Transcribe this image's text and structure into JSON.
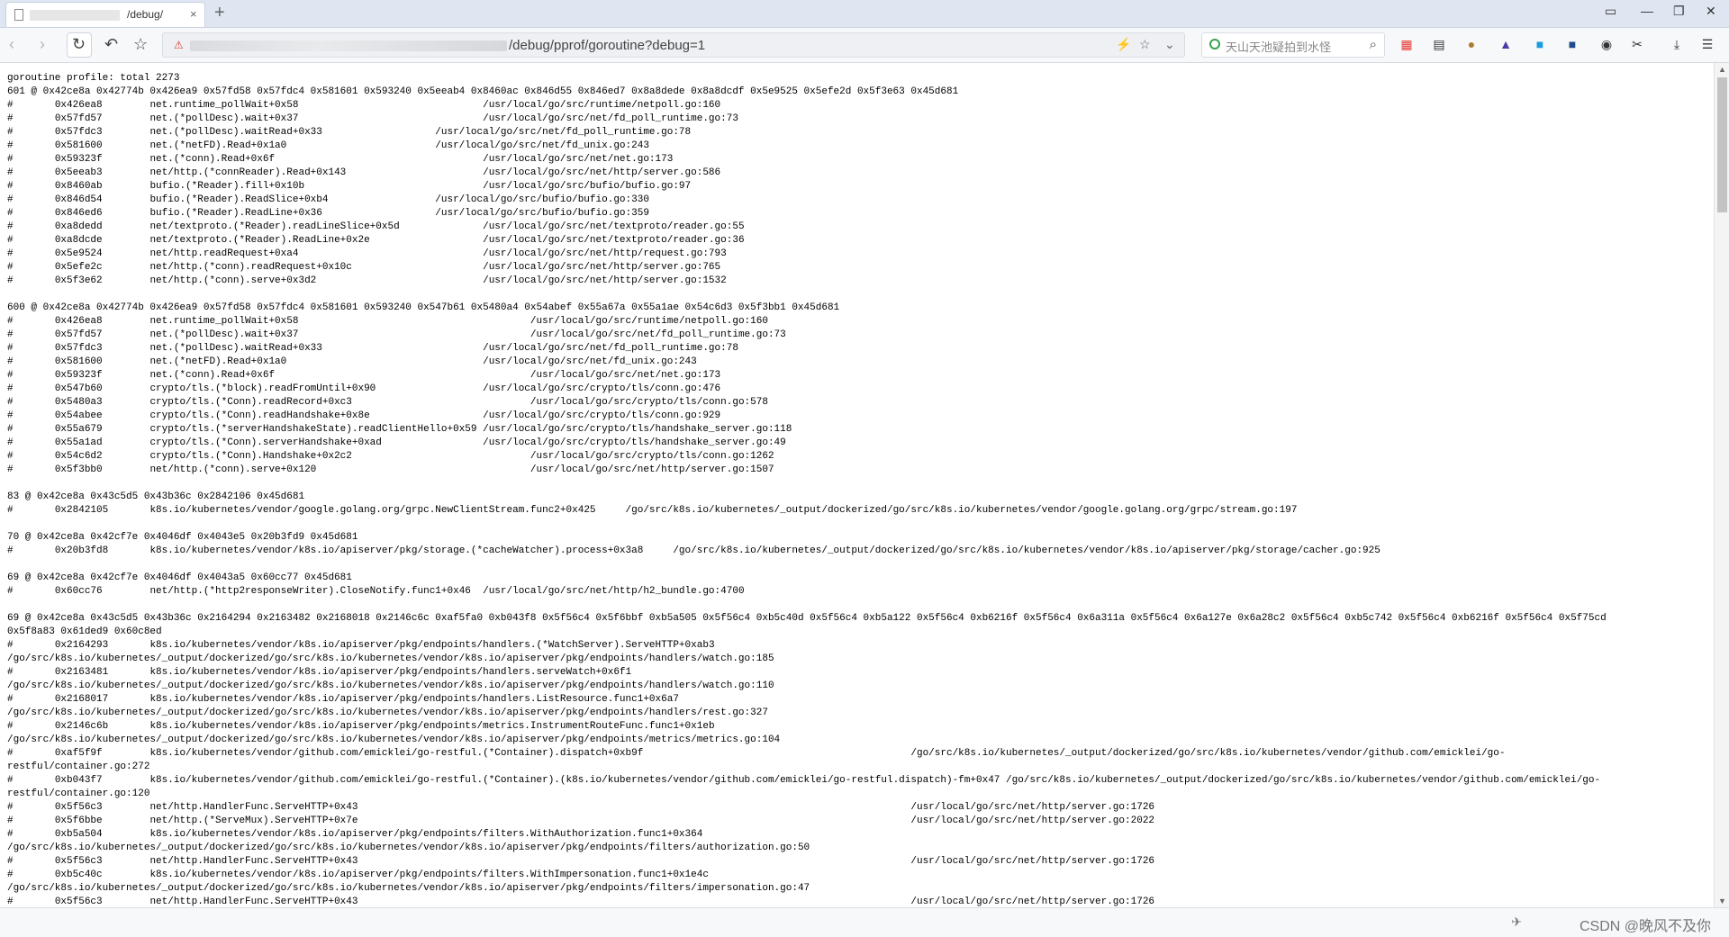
{
  "browser": {
    "tab_title": "/debug/",
    "tab_close": "×",
    "new_tab": "+",
    "url_path": "/debug/pprof/goroutine?debug=1",
    "search_placeholder": "天山天池疑拍到水怪",
    "window_controls": [
      "▭",
      "—",
      "❐",
      "✕"
    ]
  },
  "icons": {
    "back": "chevron-left-icon",
    "forward": "chevron-right-icon",
    "refresh": "refresh-icon",
    "undo": "undo-icon",
    "favorite": "star-icon",
    "search": "magnifier-icon",
    "download": "download-icon",
    "menu": "hamburger-icon"
  },
  "page": {
    "lines": [
      "goroutine profile: total 2273",
      "601 @ 0x42ce8a 0x42774b 0x426ea9 0x57fd58 0x57fdc4 0x581601 0x593240 0x5eeab4 0x8460ac 0x846d55 0x846ed7 0x8a8dede 0x8a8dcdf 0x5e9525 0x5efe2d 0x5f3e63 0x45d681",
      "#\t0x426ea8\tnet.runtime_pollWait+0x58\t\t\t\t/usr/local/go/src/runtime/netpoll.go:160",
      "#\t0x57fd57\tnet.(*pollDesc).wait+0x37\t\t\t\t/usr/local/go/src/net/fd_poll_runtime.go:73",
      "#\t0x57fdc3\tnet.(*pollDesc).waitRead+0x33\t\t\t/usr/local/go/src/net/fd_poll_runtime.go:78",
      "#\t0x581600\tnet.(*netFD).Read+0x1a0\t\t\t\t/usr/local/go/src/net/fd_unix.go:243",
      "#\t0x59323f\tnet.(*conn).Read+0x6f\t\t\t\t\t/usr/local/go/src/net/net.go:173",
      "#\t0x5eeab3\tnet/http.(*connReader).Read+0x143\t\t\t/usr/local/go/src/net/http/server.go:586",
      "#\t0x8460ab\tbufio.(*Reader).fill+0x10b\t\t\t\t/usr/local/go/src/bufio/bufio.go:97",
      "#\t0x846d54\tbufio.(*Reader).ReadSlice+0xb4\t\t\t/usr/local/go/src/bufio/bufio.go:330",
      "#\t0x846ed6\tbufio.(*Reader).ReadLine+0x36\t\t\t/usr/local/go/src/bufio/bufio.go:359",
      "#\t0xa8dedd\tnet/textproto.(*Reader).readLineSlice+0x5d\t\t/usr/local/go/src/net/textproto/reader.go:55",
      "#\t0xa8dcde\tnet/textproto.(*Reader).ReadLine+0x2e\t\t\t/usr/local/go/src/net/textproto/reader.go:36",
      "#\t0x5e9524\tnet/http.readRequest+0xa4\t\t\t\t/usr/local/go/src/net/http/request.go:793",
      "#\t0x5efe2c\tnet/http.(*conn).readRequest+0x10c\t\t\t/usr/local/go/src/net/http/server.go:765",
      "#\t0x5f3e62\tnet/http.(*conn).serve+0x3d2\t\t\t\t/usr/local/go/src/net/http/server.go:1532",
      "",
      "600 @ 0x42ce8a 0x42774b 0x426ea9 0x57fd58 0x57fdc4 0x581601 0x593240 0x547b61 0x5480a4 0x54abef 0x55a67a 0x55a1ae 0x54c6d3 0x5f3bb1 0x45d681",
      "#\t0x426ea8\tnet.runtime_pollWait+0x58\t\t\t\t\t/usr/local/go/src/runtime/netpoll.go:160",
      "#\t0x57fd57\tnet.(*pollDesc).wait+0x37\t\t\t\t\t/usr/local/go/src/net/fd_poll_runtime.go:73",
      "#\t0x57fdc3\tnet.(*pollDesc).waitRead+0x33\t\t\t\t/usr/local/go/src/net/fd_poll_runtime.go:78",
      "#\t0x581600\tnet.(*netFD).Read+0x1a0\t\t\t\t\t/usr/local/go/src/net/fd_unix.go:243",
      "#\t0x59323f\tnet.(*conn).Read+0x6f\t\t\t\t\t\t/usr/local/go/src/net/net.go:173",
      "#\t0x547b60\tcrypto/tls.(*block).readFromUntil+0x90\t\t\t/usr/local/go/src/crypto/tls/conn.go:476",
      "#\t0x5480a3\tcrypto/tls.(*Conn).readRecord+0xc3\t\t\t\t/usr/local/go/src/crypto/tls/conn.go:578",
      "#\t0x54abee\tcrypto/tls.(*Conn).readHandshake+0x8e\t\t\t/usr/local/go/src/crypto/tls/conn.go:929",
      "#\t0x55a679\tcrypto/tls.(*serverHandshakeState).readClientHello+0x59\t/usr/local/go/src/crypto/tls/handshake_server.go:118",
      "#\t0x55a1ad\tcrypto/tls.(*Conn).serverHandshake+0xad\t\t\t/usr/local/go/src/crypto/tls/handshake_server.go:49",
      "#\t0x54c6d2\tcrypto/tls.(*Conn).Handshake+0x2c2\t\t\t\t/usr/local/go/src/crypto/tls/conn.go:1262",
      "#\t0x5f3bb0\tnet/http.(*conn).serve+0x120\t\t\t\t\t/usr/local/go/src/net/http/server.go:1507",
      "",
      "83 @ 0x42ce8a 0x43c5d5 0x43b36c 0x2842106 0x45d681",
      "#\t0x2842105\tk8s.io/kubernetes/vendor/google.golang.org/grpc.NewClientStream.func2+0x425\t/go/src/k8s.io/kubernetes/_output/dockerized/go/src/k8s.io/kubernetes/vendor/google.golang.org/grpc/stream.go:197",
      "",
      "70 @ 0x42ce8a 0x42cf7e 0x4046df 0x4043e5 0x20b3fd9 0x45d681",
      "#\t0x20b3fd8\tk8s.io/kubernetes/vendor/k8s.io/apiserver/pkg/storage.(*cacheWatcher).process+0x3a8\t/go/src/k8s.io/kubernetes/_output/dockerized/go/src/k8s.io/kubernetes/vendor/k8s.io/apiserver/pkg/storage/cacher.go:925",
      "",
      "69 @ 0x42ce8a 0x42cf7e 0x4046df 0x4043a5 0x60cc77 0x45d681",
      "#\t0x60cc76\tnet/http.(*http2responseWriter).CloseNotify.func1+0x46\t/usr/local/go/src/net/http/h2_bundle.go:4700",
      "",
      "69 @ 0x42ce8a 0x43c5d5 0x43b36c 0x2164294 0x2163482 0x2168018 0x2146c6c 0xaf5fa0 0xb043f8 0x5f56c4 0x5f6bbf 0xb5a505 0x5f56c4 0xb5c40d 0x5f56c4 0xb5a122 0x5f56c4 0xb6216f 0x5f56c4 0x6a311a 0x5f56c4 0x6a127e 0x6a28c2 0x5f56c4 0xb5c742 0x5f56c4 0xb6216f 0x5f56c4 0x5f75cd",
      "0x5f8a83 0x61ded9 0x60c8ed",
      "#\t0x2164293\tk8s.io/kubernetes/vendor/k8s.io/apiserver/pkg/endpoints/handlers.(*WatchServer).ServeHTTP+0xab3",
      "/go/src/k8s.io/kubernetes/_output/dockerized/go/src/k8s.io/kubernetes/vendor/k8s.io/apiserver/pkg/endpoints/handlers/watch.go:185",
      "#\t0x2163481\tk8s.io/kubernetes/vendor/k8s.io/apiserver/pkg/endpoints/handlers.serveWatch+0x6f1",
      "/go/src/k8s.io/kubernetes/_output/dockerized/go/src/k8s.io/kubernetes/vendor/k8s.io/apiserver/pkg/endpoints/handlers/watch.go:110",
      "#\t0x2168017\tk8s.io/kubernetes/vendor/k8s.io/apiserver/pkg/endpoints/handlers.ListResource.func1+0x6a7",
      "/go/src/k8s.io/kubernetes/_output/dockerized/go/src/k8s.io/kubernetes/vendor/k8s.io/apiserver/pkg/endpoints/handlers/rest.go:327",
      "#\t0x2146c6b\tk8s.io/kubernetes/vendor/k8s.io/apiserver/pkg/endpoints/metrics.InstrumentRouteFunc.func1+0x1eb",
      "/go/src/k8s.io/kubernetes/_output/dockerized/go/src/k8s.io/kubernetes/vendor/k8s.io/apiserver/pkg/endpoints/metrics/metrics.go:104",
      "#\t0xaf5f9f\tk8s.io/kubernetes/vendor/github.com/emicklei/go-restful.(*Container).dispatch+0xb9f\t\t\t\t\t\t/go/src/k8s.io/kubernetes/_output/dockerized/go/src/k8s.io/kubernetes/vendor/github.com/emicklei/go-",
      "restful/container.go:272",
      "#\t0xb043f7\tk8s.io/kubernetes/vendor/github.com/emicklei/go-restful.(*Container).(k8s.io/kubernetes/vendor/github.com/emicklei/go-restful.dispatch)-fm+0x47 /go/src/k8s.io/kubernetes/_output/dockerized/go/src/k8s.io/kubernetes/vendor/github.com/emicklei/go-",
      "restful/container.go:120",
      "#\t0x5f56c3\tnet/http.HandlerFunc.ServeHTTP+0x43\t\t\t\t\t\t\t\t\t\t\t\t/usr/local/go/src/net/http/server.go:1726",
      "#\t0x5f6bbe\tnet/http.(*ServeMux).ServeHTTP+0x7e\t\t\t\t\t\t\t\t\t\t\t\t/usr/local/go/src/net/http/server.go:2022",
      "#\t0xb5a504\tk8s.io/kubernetes/vendor/k8s.io/apiserver/pkg/endpoints/filters.WithAuthorization.func1+0x364",
      "/go/src/k8s.io/kubernetes/_output/dockerized/go/src/k8s.io/kubernetes/vendor/k8s.io/apiserver/pkg/endpoints/filters/authorization.go:50",
      "#\t0x5f56c3\tnet/http.HandlerFunc.ServeHTTP+0x43\t\t\t\t\t\t\t\t\t\t\t\t/usr/local/go/src/net/http/server.go:1726",
      "#\t0xb5c40c\tk8s.io/kubernetes/vendor/k8s.io/apiserver/pkg/endpoints/filters.WithImpersonation.func1+0x1e4c",
      "/go/src/k8s.io/kubernetes/_output/dockerized/go/src/k8s.io/kubernetes/vendor/k8s.io/apiserver/pkg/endpoints/filters/impersonation.go:47",
      "#\t0x5f56c3\tnet/http.HandlerFunc.ServeHTTP+0x43\t\t\t\t\t\t\t\t\t\t\t\t/usr/local/go/src/net/http/server.go:1726"
    ]
  },
  "status": {
    "watermark": "CSDN @晚风不及你"
  }
}
